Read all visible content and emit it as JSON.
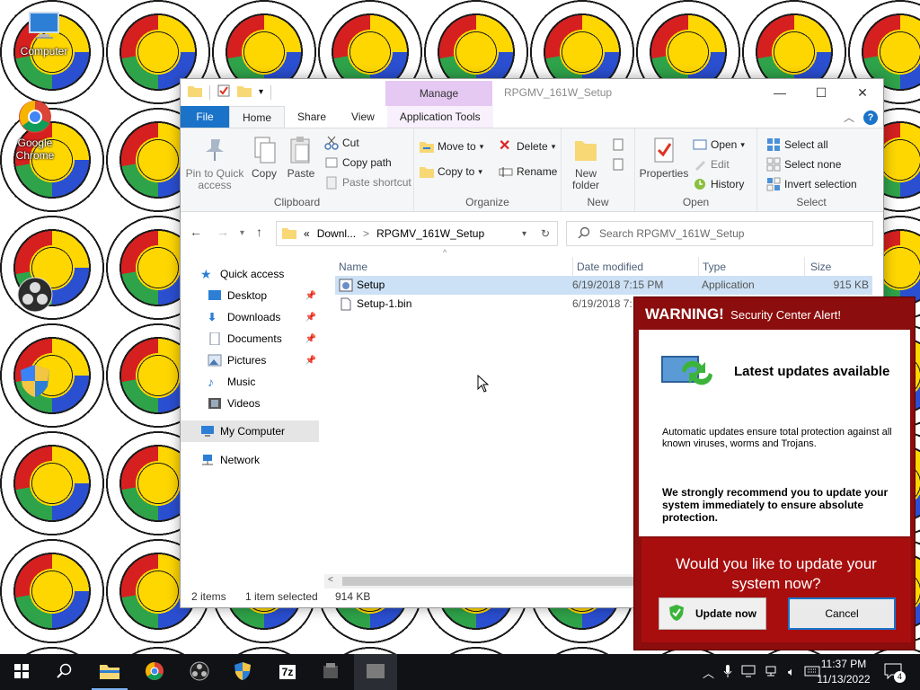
{
  "desktop": {
    "icons": [
      {
        "label": "Computer",
        "icon": "computer-icon"
      },
      {
        "label": "Google Chrome",
        "icon": "chrome-icon"
      },
      {
        "label": "",
        "icon": "obs-icon"
      },
      {
        "label": "",
        "icon": "shield-icon"
      }
    ]
  },
  "explorer": {
    "title": "RPGMV_161W_Setup",
    "contextual_tab": "Manage",
    "tabs": [
      "File",
      "Home",
      "Share",
      "View",
      "Application Tools"
    ],
    "ribbon": {
      "clipboard": {
        "label": "Clipboard",
        "pin": "Pin to Quick access",
        "copy": "Copy",
        "paste": "Paste",
        "cut": "Cut",
        "copy_path": "Copy path",
        "paste_shortcut": "Paste shortcut"
      },
      "organize": {
        "label": "Organize",
        "move_to": "Move to",
        "copy_to": "Copy to",
        "delete": "Delete",
        "rename": "Rename"
      },
      "new": {
        "label": "New",
        "new_folder": "New folder"
      },
      "open": {
        "label": "Open",
        "properties": "Properties",
        "open": "Open",
        "edit": "Edit",
        "history": "History"
      },
      "select": {
        "label": "Select",
        "select_all": "Select all",
        "select_none": "Select none",
        "invert": "Invert selection"
      }
    },
    "address": {
      "prefix": "«",
      "crumb1": "Downl...",
      "sep": ">",
      "crumb2": "RPGMV_161W_Setup"
    },
    "search_placeholder": "Search RPGMV_161W_Setup",
    "nav": [
      {
        "label": "Quick access",
        "icon": "star-icon"
      },
      {
        "label": "Desktop",
        "icon": "desktop-icon",
        "pinned": true
      },
      {
        "label": "Downloads",
        "icon": "download-icon",
        "pinned": true
      },
      {
        "label": "Documents",
        "icon": "documents-icon",
        "pinned": true
      },
      {
        "label": "Pictures",
        "icon": "pictures-icon",
        "pinned": true
      },
      {
        "label": "Music",
        "icon": "music-icon"
      },
      {
        "label": "Videos",
        "icon": "videos-icon"
      },
      {
        "label": "My Computer",
        "icon": "computer-icon"
      },
      {
        "label": "Network",
        "icon": "network-icon"
      }
    ],
    "columns": [
      "Name",
      "Date modified",
      "Type",
      "Size"
    ],
    "files": [
      {
        "name": "Setup",
        "date": "6/19/2018 7:15 PM",
        "type": "Application",
        "size": "915 KB",
        "selected": true
      },
      {
        "name": "Setup-1.bin",
        "date": "6/19/2018 7:",
        "type": "",
        "size": "",
        "selected": false
      }
    ],
    "status": {
      "items": "2 items",
      "selected": "1 item selected",
      "size": "914 KB"
    }
  },
  "alert": {
    "warning": "WARNING!",
    "subtitle": "Security Center Alert!",
    "heading": "Latest updates available",
    "para1": "Automatic updates ensure total protection against all known viruses, worms and Trojans.",
    "para2": "We strongly recommend you to update your system immediately to ensure absolute protection.",
    "question": "Would you like to update your system now?",
    "update_button": "Update now",
    "cancel_button": "Cancel",
    "colors": {
      "frame": "#8c0d0d",
      "cta": "#a80e0e"
    }
  },
  "taskbar": {
    "apps": [
      "start-icon",
      "search-icon",
      "file-explorer-icon",
      "chrome-icon",
      "obs-icon",
      "shield-icon",
      "7zip-icon",
      "installer-icon"
    ],
    "time": "11:37 PM",
    "date": "11/13/2022",
    "notifications": "4",
    "sevenzip": "7z"
  }
}
